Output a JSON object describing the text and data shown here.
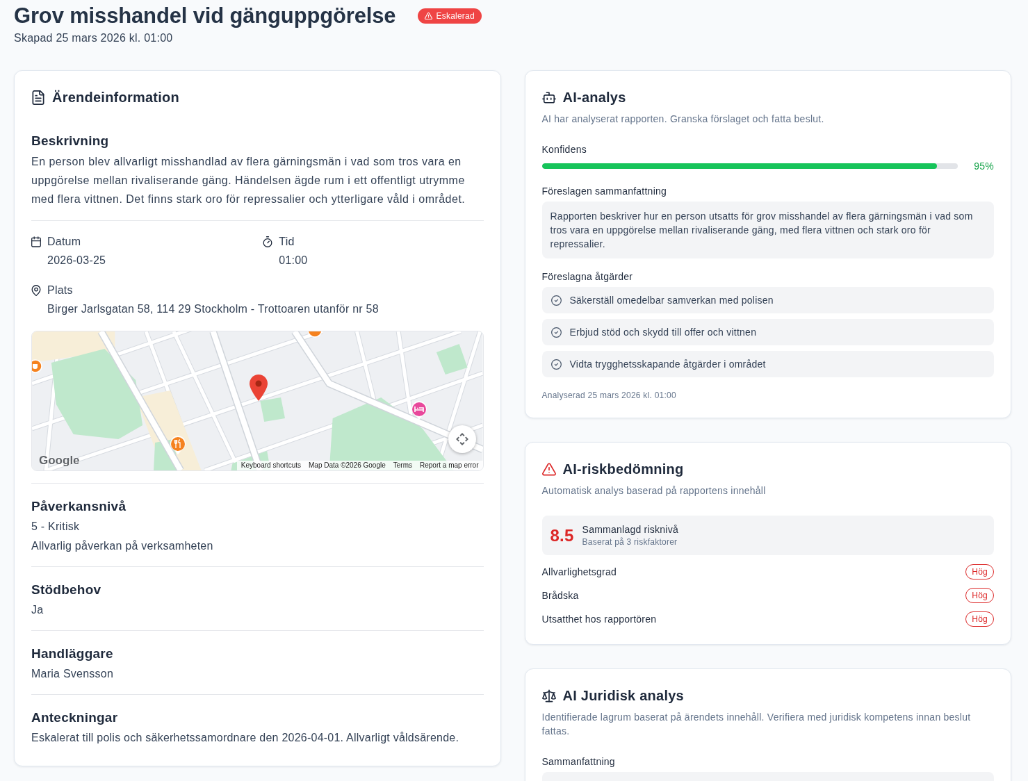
{
  "header": {
    "title": "Grov misshandel vid gänguppgörelse",
    "status_badge": {
      "label": "Eskalerad"
    },
    "created": "Skapad 25 mars 2026 kl. 01:00"
  },
  "case_info": {
    "title": "Ärendeinformation",
    "description": {
      "heading": "Beskrivning",
      "text": "En person blev allvarligt misshandlad av flera gärningsmän i vad som tros vara en uppgörelse mellan rivaliserande gäng. Händelsen ägde rum i ett offentligt utrymme med flera vittnen. Det finns stark oro för repressalier och ytterligare våld i området."
    },
    "details": [
      {
        "kind": "date",
        "label": "Datum",
        "value": "2026-03-25"
      },
      {
        "kind": "time",
        "label": "Tid",
        "value": "01:00"
      },
      {
        "kind": "location",
        "label": "Plats",
        "value": "Birger Jarlsgatan 58, 114 29 Stockholm - Trottoaren utanför nr 58"
      }
    ],
    "map": {
      "logo": "Google",
      "attribution": [
        "Keyboard shortcuts",
        "Map Data ©2026 Google",
        "Terms",
        "Report a map error"
      ]
    },
    "sections": [
      {
        "heading": "Påverkansnivå",
        "lines": [
          "5 - Kritisk",
          "Allvarlig påverkan på verksamheten"
        ]
      },
      {
        "heading": "Stödbehov",
        "lines": [
          "Ja"
        ]
      },
      {
        "heading": "Handläggare",
        "lines": [
          "Maria Svensson"
        ]
      },
      {
        "heading": "Anteckningar",
        "lines": [
          "Eskalerat till polis och säkerhetssamordnare den 2026-04-01. Allvarligt våldsärende."
        ]
      }
    ]
  },
  "ai_analysis": {
    "title": "AI-analys",
    "subtitle": "AI har analyserat rapporten. Granska förslaget och fatta beslut.",
    "confidence": {
      "label": "Konfidens",
      "level": 0.95,
      "reading": "95%"
    },
    "summary": {
      "label": "Föreslagen sammanfattning",
      "text": "Rapporten beskriver hur en person utsatts för grov misshandel av flera gärningsmän i vad som tros vara en uppgörelse mellan rivaliserande gäng, med flera vittnen och stark oro för repressalier."
    },
    "actions": {
      "label": "Föreslagna åtgärder",
      "items": [
        "Säkerställ omedelbar samverkan med polisen",
        "Erbjud stöd och skydd till offer och vittnen",
        "Vidta trygghetsskapande åtgärder i området"
      ]
    },
    "footer": "Analyserad 25 mars 2026 kl. 01:00"
  },
  "risk_assessment": {
    "title": "AI-riskbedömning",
    "subtitle": "Automatisk analys baserad på rapportens innehåll",
    "total": {
      "score": "8.5",
      "label": "Sammanlagd risknivå",
      "note": "Baserat på 3 riskfaktorer"
    },
    "factors": [
      {
        "name": "Allvarlighetsgrad",
        "rating": "Hög"
      },
      {
        "name": "Brådska",
        "rating": "Hög"
      },
      {
        "name": "Utsatthet hos rapportören",
        "rating": "Hög"
      }
    ]
  },
  "legal_analysis": {
    "title": "AI Juridisk analys",
    "subtitle": "Identifierade lagrum baserat på ärendets innehåll. Verifiera med juridisk kompetens innan beslut fattas.",
    "summary_label": "Sammanfattning"
  }
}
